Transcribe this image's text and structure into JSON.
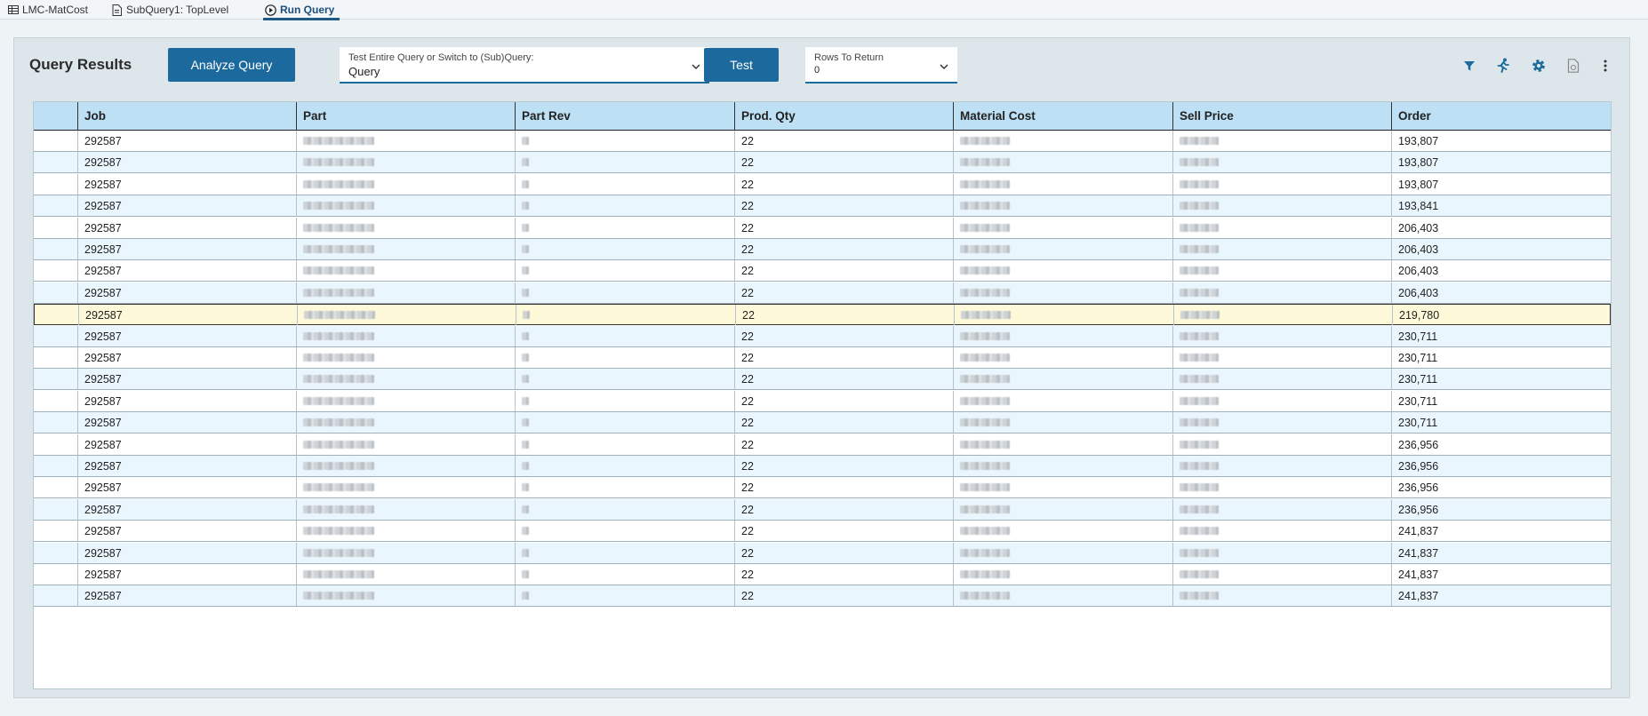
{
  "tabs": [
    {
      "label": "LMC-MatCost",
      "icon": "table-icon"
    },
    {
      "label": "SubQuery1: TopLevel",
      "icon": "document-icon"
    },
    {
      "label": "Run Query",
      "icon": "play-circle-icon",
      "active": true
    }
  ],
  "toolbar": {
    "title": "Query Results",
    "analyze_label": "Analyze Query",
    "subquery_label": "Test Entire Query or Switch to (Sub)Query:",
    "subquery_value": "Query",
    "test_label": "Test",
    "rows_label": "Rows To Return",
    "rows_value": "0",
    "icons": [
      "filter-icon",
      "running-man-icon",
      "gear-icon",
      "export-document-icon",
      "more-vertical-icon"
    ]
  },
  "colors": {
    "accent": "#1c6a9d",
    "header_bg": "#bde0f5",
    "row_alt": "#eaf6fd",
    "selected_row": "#fdf9d9"
  },
  "grid": {
    "columns": [
      "Job",
      "Part",
      "Part Rev",
      "Prod. Qty",
      "Material Cost",
      "Sell Price",
      "Order"
    ],
    "selected_row": 8,
    "rows": [
      {
        "job": "292587",
        "qty": "22",
        "order": "193,807"
      },
      {
        "job": "292587",
        "qty": "22",
        "order": "193,807"
      },
      {
        "job": "292587",
        "qty": "22",
        "order": "193,807"
      },
      {
        "job": "292587",
        "qty": "22",
        "order": "193,841"
      },
      {
        "job": "292587",
        "qty": "22",
        "order": "206,403"
      },
      {
        "job": "292587",
        "qty": "22",
        "order": "206,403"
      },
      {
        "job": "292587",
        "qty": "22",
        "order": "206,403"
      },
      {
        "job": "292587",
        "qty": "22",
        "order": "206,403"
      },
      {
        "job": "292587",
        "qty": "22",
        "order": "219,780"
      },
      {
        "job": "292587",
        "qty": "22",
        "order": "230,711"
      },
      {
        "job": "292587",
        "qty": "22",
        "order": "230,711"
      },
      {
        "job": "292587",
        "qty": "22",
        "order": "230,711"
      },
      {
        "job": "292587",
        "qty": "22",
        "order": "230,711"
      },
      {
        "job": "292587",
        "qty": "22",
        "order": "230,711"
      },
      {
        "job": "292587",
        "qty": "22",
        "order": "236,956"
      },
      {
        "job": "292587",
        "qty": "22",
        "order": "236,956"
      },
      {
        "job": "292587",
        "qty": "22",
        "order": "236,956"
      },
      {
        "job": "292587",
        "qty": "22",
        "order": "236,956"
      },
      {
        "job": "292587",
        "qty": "22",
        "order": "241,837"
      },
      {
        "job": "292587",
        "qty": "22",
        "order": "241,837"
      },
      {
        "job": "292587",
        "qty": "22",
        "order": "241,837"
      },
      {
        "job": "292587",
        "qty": "22",
        "order": "241,837"
      }
    ]
  }
}
